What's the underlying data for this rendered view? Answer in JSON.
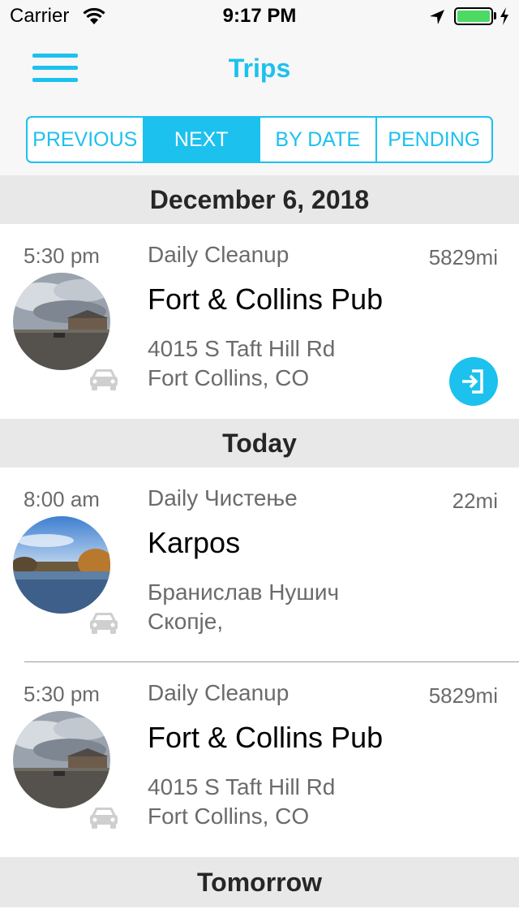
{
  "status_bar": {
    "carrier": "Carrier",
    "time": "9:17 PM"
  },
  "nav": {
    "title": "Trips",
    "menu_icon": "hamburger-menu-icon"
  },
  "segments": [
    {
      "label": "PREVIOUS",
      "selected": false
    },
    {
      "label": "NEXT",
      "selected": true
    },
    {
      "label": "BY DATE",
      "selected": false
    },
    {
      "label": "PENDING",
      "selected": false
    }
  ],
  "colors": {
    "accent": "#1cc1ee",
    "section_bg": "#e8e8e8",
    "secondary_text": "#6b6b6b",
    "battery": "#4cd964"
  },
  "sections": [
    {
      "header": "December 6, 2018",
      "trips": [
        {
          "time": "5:30 pm",
          "category": "Daily Cleanup",
          "distance": "5829mi",
          "name": "Fort & Collins Pub",
          "address_line1": "4015 S Taft Hill Rd",
          "address_line2": "Fort Collins, CO",
          "transport_icon": "car-icon",
          "action_icon": "check-in-icon"
        }
      ]
    },
    {
      "header": "Today",
      "trips": [
        {
          "time": "8:00 am",
          "category": "Daily Чистење",
          "distance": "22mi",
          "name": "Karpos",
          "address_line1": "Бранислав Нушич",
          "address_line2": "Скопје,",
          "transport_icon": "car-icon"
        },
        {
          "time": "5:30 pm",
          "category": "Daily Cleanup",
          "distance": "5829mi",
          "name": "Fort & Collins Pub",
          "address_line1": "4015 S Taft Hill Rd",
          "address_line2": "Fort Collins, CO",
          "transport_icon": "car-icon"
        }
      ]
    },
    {
      "header": "Tomorrow",
      "trips": []
    }
  ]
}
